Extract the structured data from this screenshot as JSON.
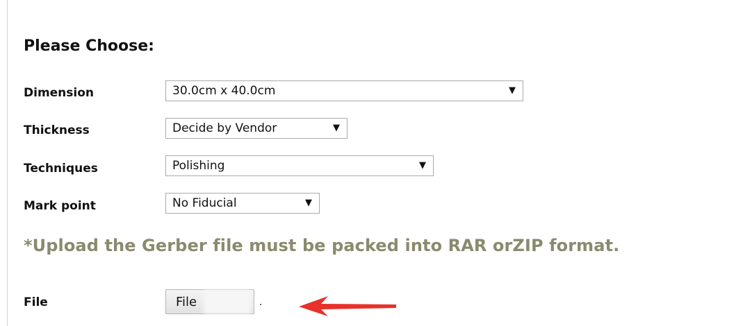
{
  "heading": "Please Choose:",
  "fields": {
    "dimension": {
      "label": "Dimension",
      "value": "30.0cm x 40.0cm"
    },
    "thickness": {
      "label": "Thickness",
      "value": "Decide by Vendor"
    },
    "techniques": {
      "label": "Techniques",
      "value": "Polishing"
    },
    "mark_point": {
      "label": "Mark point",
      "value": "No Fiducial"
    }
  },
  "dropdown_arrow_glyph": "▼",
  "notice": "*Upload the Gerber file must be packed into RAR orZIP format.",
  "file": {
    "label": "File",
    "button_label": "File"
  },
  "colors": {
    "notice_text": "#8a8a6e",
    "annotation_arrow": "#e8312a"
  },
  "icons": {
    "dropdown": "chevron-down-icon",
    "annotation": "red-arrow-icon"
  }
}
